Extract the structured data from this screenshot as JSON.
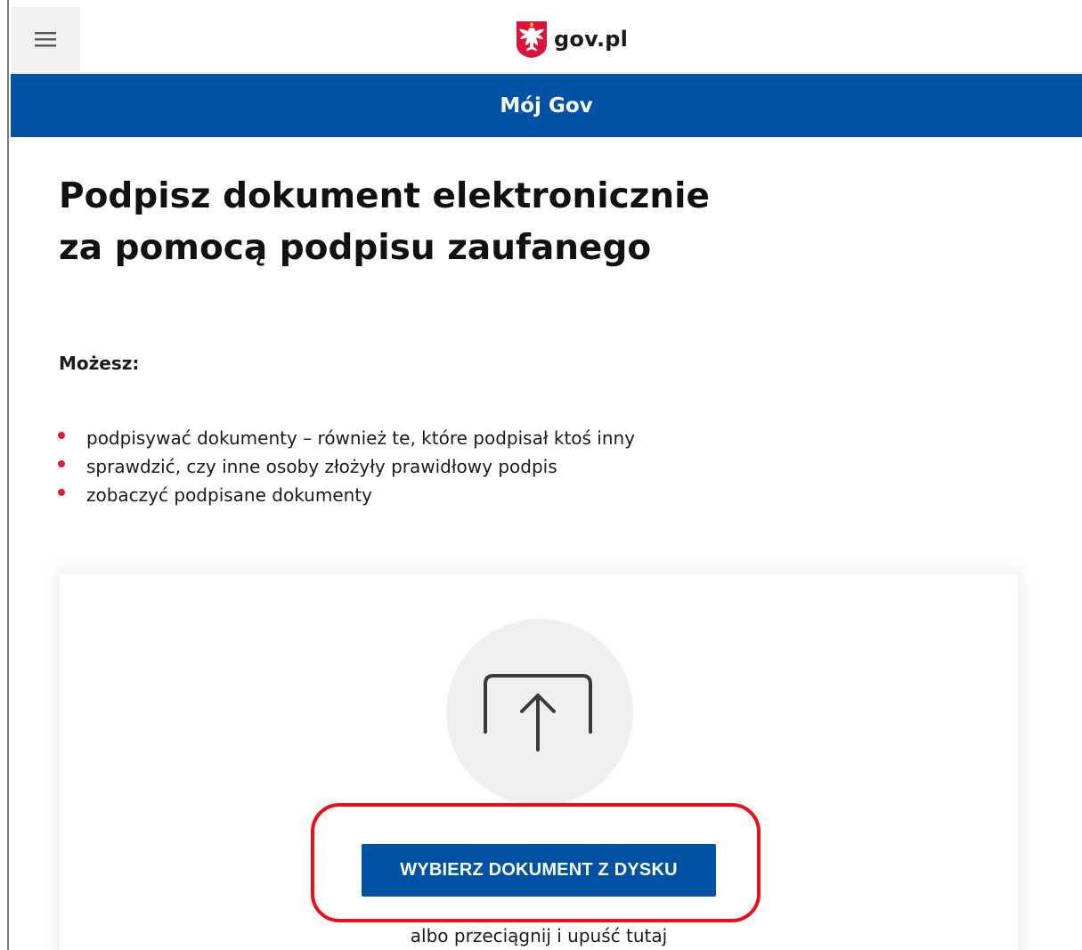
{
  "header": {
    "menu_icon": "hamburger-menu-icon",
    "logo_text": "gov.pl",
    "logo_icon": "polish-eagle-emblem-icon",
    "section_title": "Mój Gov"
  },
  "main": {
    "title_line1": "Podpisz dokument elektronicznie",
    "title_line2": "za pomocą podpisu zaufanego",
    "lead": "Możesz:",
    "bullets": [
      "podpisywać dokumenty – również te, które podpisał ktoś inny",
      "sprawdzić, czy inne osoby złożyły prawidłowy podpis",
      "zobaczyć podpisane dokumenty"
    ]
  },
  "upload": {
    "icon": "upload-icon",
    "button_label": "WYBIERZ DOKUMENT Z DYSKU",
    "drop_hint": "albo przeciągnij i upuść tutaj"
  },
  "colors": {
    "brand_blue": "#0052a5",
    "bullet_red": "#d4213d",
    "highlight_red": "#e8101b"
  }
}
